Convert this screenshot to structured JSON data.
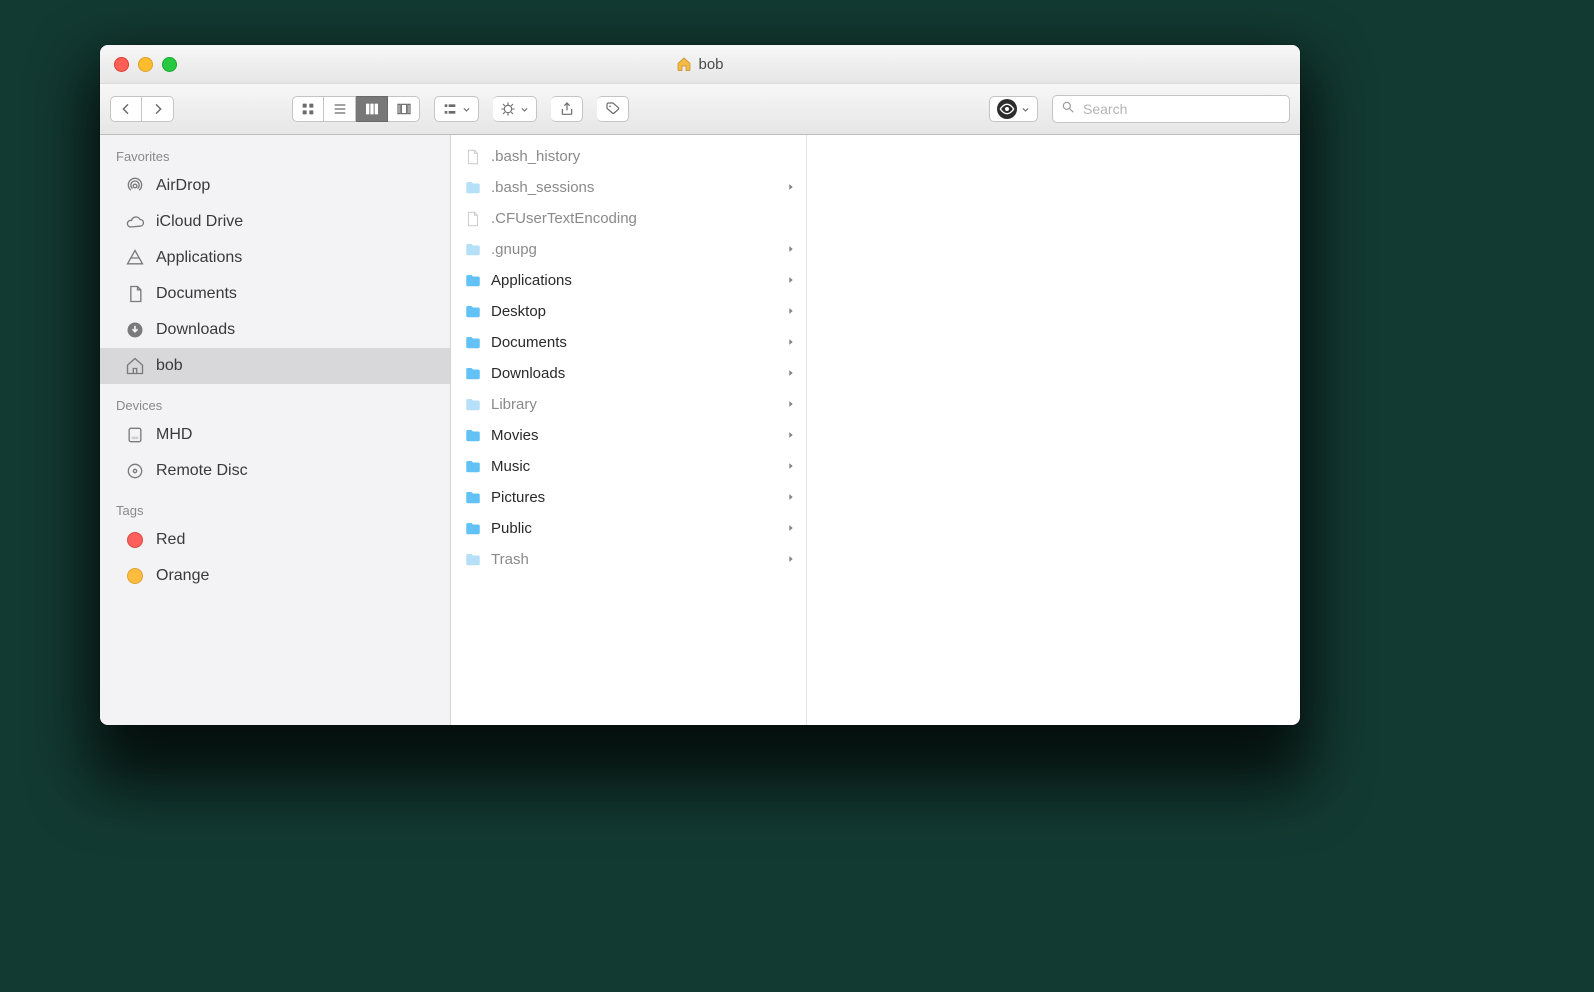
{
  "title": "bob",
  "search": {
    "placeholder": "Search"
  },
  "sidebar": {
    "sections": [
      {
        "heading": "Favorites",
        "items": [
          {
            "label": "AirDrop",
            "icon": "airdrop-icon",
            "selected": false
          },
          {
            "label": "iCloud Drive",
            "icon": "cloud-icon",
            "selected": false
          },
          {
            "label": "Applications",
            "icon": "applications-icon",
            "selected": false
          },
          {
            "label": "Documents",
            "icon": "documents-icon",
            "selected": false
          },
          {
            "label": "Downloads",
            "icon": "downloads-icon",
            "selected": false
          },
          {
            "label": "bob",
            "icon": "home-icon",
            "selected": true
          }
        ]
      },
      {
        "heading": "Devices",
        "items": [
          {
            "label": "MHD",
            "icon": "disk-icon",
            "selected": false
          },
          {
            "label": "Remote Disc",
            "icon": "optical-disc-icon",
            "selected": false
          }
        ]
      },
      {
        "heading": "Tags",
        "items": [
          {
            "label": "Red",
            "icon": "tag-dot",
            "color": "#fc605c",
            "selected": false
          },
          {
            "label": "Orange",
            "icon": "tag-dot",
            "color": "#fdbc40",
            "selected": false
          }
        ]
      }
    ]
  },
  "column": {
    "items": [
      {
        "label": ".bash_history",
        "type": "file",
        "dim": true
      },
      {
        "label": ".bash_sessions",
        "type": "folder",
        "dim": true
      },
      {
        "label": ".CFUserTextEncoding",
        "type": "file",
        "dim": true
      },
      {
        "label": ".gnupg",
        "type": "folder",
        "dim": true
      },
      {
        "label": "Applications",
        "type": "folder",
        "dim": false
      },
      {
        "label": "Desktop",
        "type": "folder",
        "dim": false
      },
      {
        "label": "Documents",
        "type": "folder",
        "dim": false
      },
      {
        "label": "Downloads",
        "type": "folder",
        "dim": false
      },
      {
        "label": "Library",
        "type": "folder",
        "dim": true
      },
      {
        "label": "Movies",
        "type": "folder",
        "dim": false
      },
      {
        "label": "Music",
        "type": "folder",
        "dim": false
      },
      {
        "label": "Pictures",
        "type": "folder",
        "dim": false
      },
      {
        "label": "Public",
        "type": "folder",
        "dim": false
      },
      {
        "label": "Trash",
        "type": "folder",
        "dim": true
      }
    ]
  }
}
